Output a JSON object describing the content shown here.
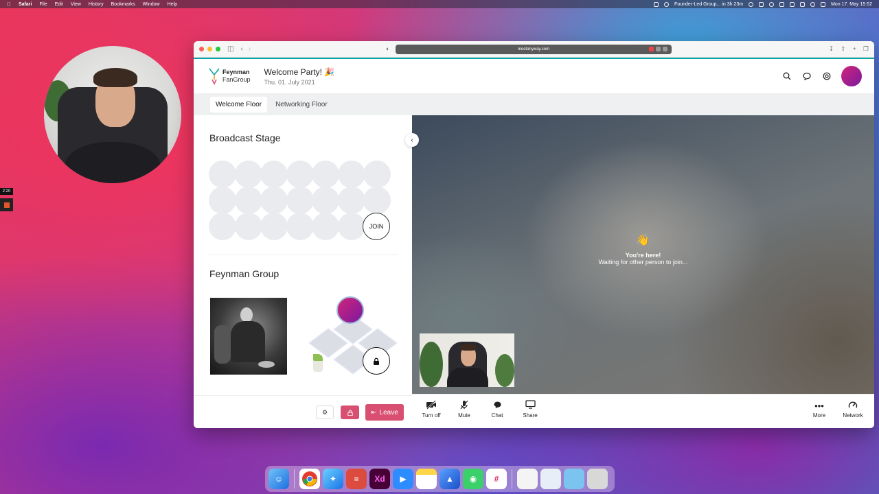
{
  "menubar": {
    "app_name": "Safari",
    "menus": [
      "File",
      "Edit",
      "View",
      "History",
      "Bookmarks",
      "Window",
      "Help"
    ],
    "status_event": "Founder-Led Group... in 3h 23m",
    "datetime": "Mon 17. May 15:52"
  },
  "recorder": {
    "time": "2:20"
  },
  "browser": {
    "url": "meetanyway.com"
  },
  "header": {
    "logo_line1": "Feynman",
    "logo_line2": "FanGroup",
    "event_title": "Welcome Party! 🎉",
    "event_date": "Thu. 01. July 2021"
  },
  "tabs": [
    {
      "label": "Welcome Floor",
      "active": true
    },
    {
      "label": "Networking Floor",
      "active": false
    }
  ],
  "left_panel": {
    "broadcast_title": "Broadcast Stage",
    "join_label": "JOIN",
    "group_title": "Feynman Group",
    "leave_label": "Leave"
  },
  "video": {
    "wave": "👋",
    "headline": "You're here!",
    "waiting": "Waiting for other person to join..."
  },
  "controls": {
    "turn_off": "Turn off",
    "mute": "Mute",
    "chat": "Chat",
    "share": "Share",
    "more": "More",
    "network": "Network"
  },
  "colors": {
    "accent": "#d94f72",
    "brand_teal": "#0aa5a5",
    "avatar_gradient_start": "#d22477",
    "avatar_gradient_end": "#7a1aa0"
  }
}
